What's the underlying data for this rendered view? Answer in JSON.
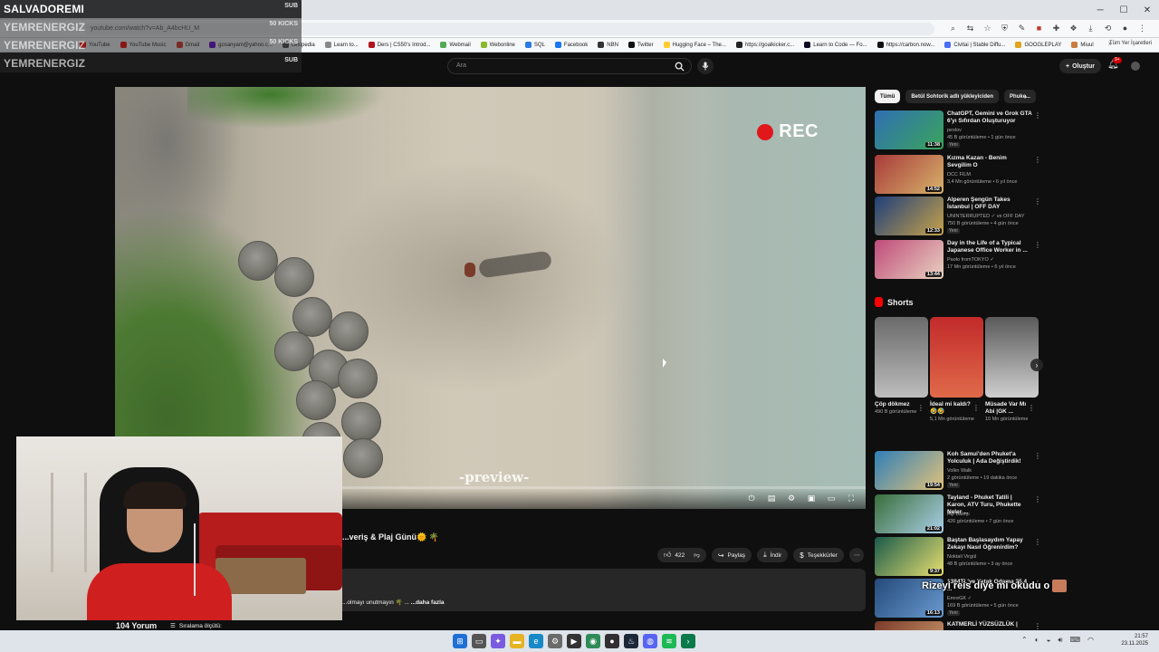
{
  "overlay": {
    "rows": [
      {
        "name": "SALVADOREMI",
        "tag": "SUB"
      },
      {
        "name": "YEMRENERGIZ",
        "tag": "50 KICKS"
      },
      {
        "name": "YEMRENERGIZ",
        "tag": "50 KICKS"
      },
      {
        "name": "YEMRENERGIZ",
        "tag": "SUB"
      }
    ]
  },
  "browser": {
    "url": "youtube.com/watch?v=Ab_A4bcHU_M",
    "bookmarks": [
      "YouTube",
      "YouTube Music",
      "Gmail",
      "gosanyam@yahoo.c...",
      "Lexipedia",
      "Learn to...",
      "Ders | CS50's Introd...",
      "Webmail",
      "Webonline",
      "SQL",
      "Facebook",
      "NBN",
      "Twitter",
      "Hugging Face – The...",
      "https://goalkicker.c...",
      "Learn to Code — Fo...",
      "https://carbon.now...",
      "Civitai | Stable Diffu...",
      "GOOGLEPLAY",
      "Miuul"
    ],
    "bookmarks_more": "»",
    "all_bookmarks": "Tüm Yer İşaretleri"
  },
  "header": {
    "search_placeholder": "Ara",
    "create_label": "Oluştur",
    "notif_count": "9+"
  },
  "player": {
    "rec_label": "REC",
    "watermark": "-preview-",
    "progress_percent": 0
  },
  "video": {
    "title": "...veriş & Plaj Günü🌞 🌴",
    "likes": "422",
    "share_label": "Paylaş",
    "download_label": "İndir",
    "thanks_label": "Teşekkürler",
    "description": "...olmayı unutmayın 🌴 ...",
    "more_label": "...daha fazla",
    "comments_count": "104 Yorum",
    "sort_label": "Sıralama ölçütü:"
  },
  "sidebar": {
    "chips": [
      "Tümü",
      "Betül Sohtorik adlı yükleyiciden",
      "Phuke..."
    ],
    "recommended_top": [
      {
        "title": "ChatGPT, Gemini ve Grok GTA 6'yı Sıfırdan Oluşturuyor",
        "channel": "pexlov",
        "meta": "45 B görüntüleme • 1 gün önce",
        "badge": "Yeni",
        "duration": "11:38",
        "color_a": "#2f6fb3",
        "color_b": "#3aa55a"
      },
      {
        "title": "Kızma Kazan - Benim Sevgilim O",
        "channel": "DCC FILM",
        "meta": "3,4 Mn görüntüleme • 6 yıl önce",
        "badge": "",
        "duration": "14:52",
        "color_a": "#a83a3a",
        "color_b": "#d7b36b"
      },
      {
        "title": "Alperen Şengün Takes İstanbul | OFF DAY",
        "channel": "UNINTERRUPTED ✓ ve OFF DAY",
        "meta": "750 B görüntüleme • 4 gün önce",
        "badge": "Yeni",
        "duration": "12:33",
        "color_a": "#1f3f7a",
        "color_b": "#c7a24a"
      },
      {
        "title": "Day in the Life of a Typical Japanese Office Worker in ...",
        "channel": "Paolo fromTOKYO ✓",
        "meta": "17 Mn görüntüleme • 6 yıl önce",
        "badge": "",
        "duration": "13:44",
        "color_a": "#c04a7a",
        "color_b": "#e8d3c0"
      }
    ],
    "shorts_label": "Shorts",
    "shorts": [
      {
        "title": "Çöp dökmez",
        "views": "490 B görüntüleme",
        "color_a": "#6a6a6a",
        "color_b": "#bdbdbd"
      },
      {
        "title": "İdeal mi kaldı? 🤣🤣",
        "views": "5,1 Mn görüntüleme",
        "color_a": "#c22a2a",
        "color_b": "#e06a4a"
      },
      {
        "title": "Müsade Var Mı Abi |GK ...",
        "views": "10 Mn görüntüleme",
        "color_a": "#5a5a5a",
        "color_b": "#cfcfcf"
      }
    ],
    "recommended_bottom": [
      {
        "title": "Koh Samui'den Phuket'a Yolculuk | Ada Değiştirdik!",
        "channel": "Volkn Walk",
        "meta": "2 görüntüleme • 19 dakika önce",
        "badge": "Yeni",
        "duration": "19:54",
        "color_a": "#2f7fb7",
        "color_b": "#e2c27a"
      },
      {
        "title": "Tayland - Phuket Tatili | Karon, ATV Turu, Phukette Neler ...",
        "channel": "Alp Bakışı",
        "meta": "426 görüntüleme • 7 gün önce",
        "badge": "",
        "duration": "21:02",
        "color_a": "#3a6e3a",
        "color_b": "#a9cfe8"
      },
      {
        "title": "Baştan Başlasaydım Yapay Zekayı Nasıl Öğrenirdim?",
        "channel": "Noktali Virgül",
        "meta": "48 B görüntüleme • 3 ay önce",
        "badge": "",
        "duration": "9:37",
        "color_a": "#1a5a4a",
        "color_b": "#e8e070"
      },
      {
        "title": "1384TL'ye Yatak Odama 25.4 ...",
        "channel": "EmreGK ✓",
        "meta": "169 B görüntüleme • 5 gün önce",
        "badge": "Yeni",
        "duration": "16:13",
        "color_a": "#244a7a",
        "color_b": "#6a9ad0"
      },
      {
        "title": "KATMERLİ YÜZSÜZLÜK |",
        "channel": "",
        "meta": "",
        "badge": "",
        "duration": "",
        "color_a": "#7a3a2a",
        "color_b": "#d0a070"
      }
    ]
  },
  "chat_overlay": "Rizeyi reis diye mi okudu o",
  "taskbar": {
    "time": "21:57",
    "date": "23.11.2025"
  },
  "colors": {
    "yt_bg": "#0f0f0f",
    "pill_bg": "#272727",
    "rec_red": "#e0171b",
    "accent_red": "#ff0000"
  }
}
